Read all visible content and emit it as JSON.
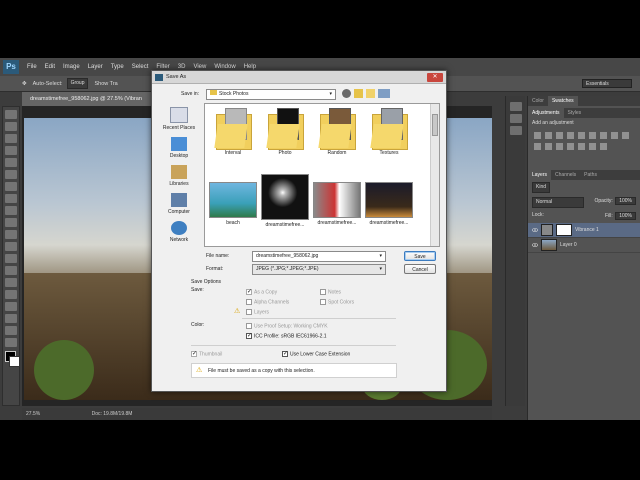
{
  "app": {
    "menu": [
      "File",
      "Edit",
      "Image",
      "Layer",
      "Type",
      "Select",
      "Filter",
      "3D",
      "View",
      "Window",
      "Help"
    ],
    "options": {
      "auto_select": "Auto-Select:",
      "group": "Group",
      "show_transform": "Show Tra"
    },
    "workspace": "Essentials",
    "doc_tab": "dreamstimefree_958062.jpg @ 27.5% (Vibran",
    "status": {
      "zoom": "27.5%",
      "doc": "Doc: 19.8M/19.8M"
    }
  },
  "panels": {
    "tabs_top": [
      "Color",
      "Swatches"
    ],
    "tabs_adj": [
      "Adjustments",
      "Styles"
    ],
    "adj_title": "Add an adjustment",
    "tabs_layers": [
      "Layers",
      "Channels",
      "Paths"
    ],
    "kind": "Kind",
    "blend": "Normal",
    "opacity_label": "Opacity:",
    "opacity_value": "100%",
    "lock_label": "Lock:",
    "fill_label": "Fill:",
    "fill_value": "100%",
    "layers": [
      {
        "name": "Vibrance 1"
      },
      {
        "name": "Layer 0"
      }
    ]
  },
  "dialog": {
    "title": "Save As",
    "save_in_label": "Save in:",
    "save_in_value": "Stock Photos",
    "nav": [
      "Recent Places",
      "Desktop",
      "Libraries",
      "Computer",
      "Network"
    ],
    "files": [
      "Interval",
      "Photo",
      "Random",
      "Textures",
      "beach",
      "dreamstimefree...",
      "dreamstimefree...",
      "dreamstimefree..."
    ],
    "file_name_label": "File name:",
    "file_name_value": "dreamstimefree_958062.jpg",
    "format_label": "Format:",
    "format_value": "JPEG (*.JPG;*.JPEG;*.JPE)",
    "save_button": "Save",
    "cancel_button": "Cancel",
    "save_options_label": "Save Options",
    "save_label": "Save:",
    "as_copy": "As a Copy",
    "notes": "Notes",
    "alpha_channels": "Alpha Channels",
    "spot_colors": "Spot Colors",
    "layers_opt": "Layers",
    "color_label": "Color:",
    "use_proof": "Use Proof Setup:",
    "proof_value": "Working CMYK",
    "icc_profile": "ICC Profile:",
    "icc_value": "sRGB IEC61966-2.1",
    "thumbnail": "Thumbnail",
    "lower_case": "Use Lower Case Extension",
    "warning": "File must be saved as a copy with this selection."
  }
}
